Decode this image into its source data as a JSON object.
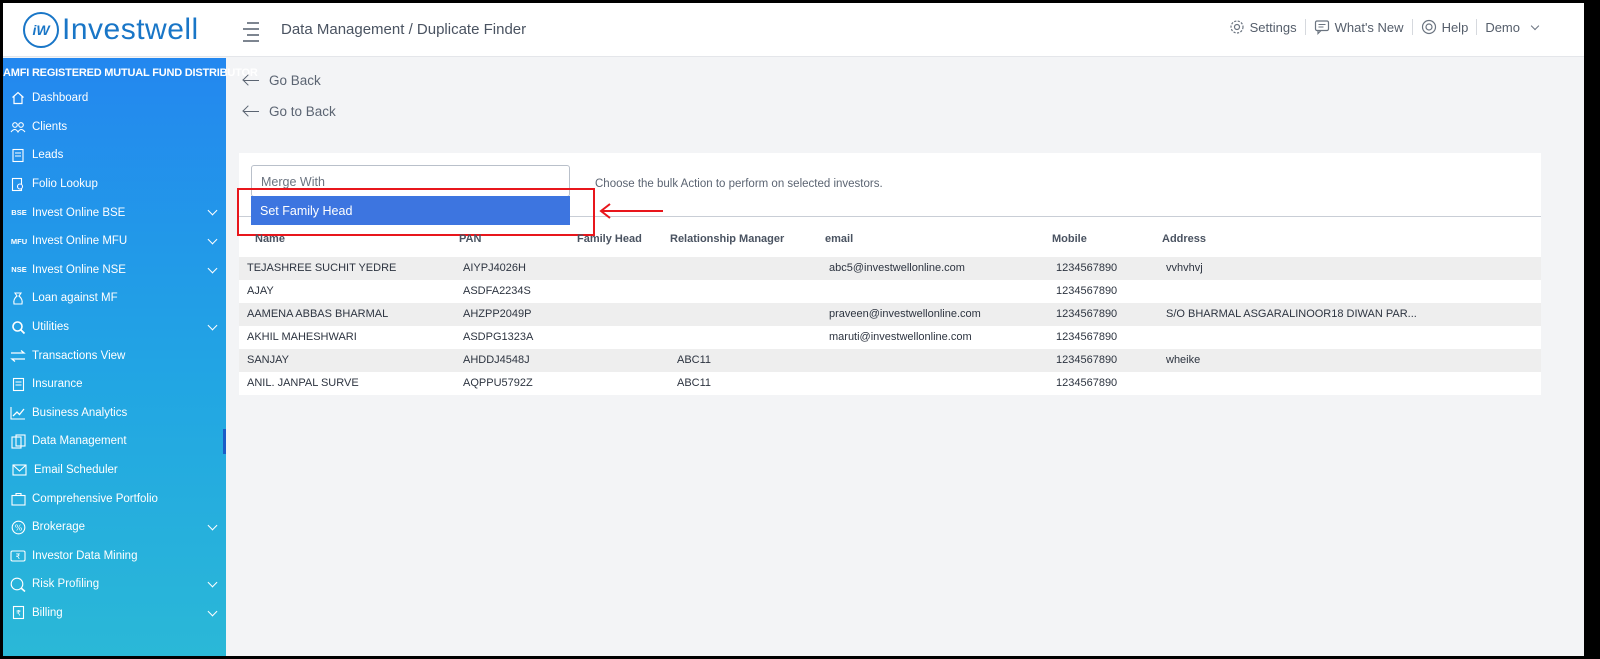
{
  "brand": {
    "logo_mark": "iW",
    "name": "Investwell"
  },
  "header": {
    "breadcrumb": "Data Management / Duplicate Finder",
    "settings": "Settings",
    "whats_new": "What's New",
    "help": "Help",
    "user": "Demo"
  },
  "sidebar": {
    "tagline": "AMFI REGISTERED MUTUAL FUND DISTRIBUTOR",
    "items": [
      {
        "label": "Dashboard",
        "icon": "home-icon"
      },
      {
        "label": "Clients",
        "icon": "clients-icon"
      },
      {
        "label": "Leads",
        "icon": "leads-icon"
      },
      {
        "label": "Folio Lookup",
        "icon": "folio-lookup-icon"
      },
      {
        "label": "Invest Online BSE",
        "icon_text": "BSE"
      },
      {
        "label": "Invest Online MFU",
        "icon_text": "MFU"
      },
      {
        "label": "Invest Online NSE",
        "icon_text": "NSE"
      },
      {
        "label": "Loan against MF",
        "icon": "loan-icon"
      },
      {
        "label": "Utilities",
        "icon": "utilities-icon"
      },
      {
        "label": "Transactions View",
        "icon": "transactions-icon"
      },
      {
        "label": "Insurance",
        "icon": "insurance-icon"
      },
      {
        "label": "Business Analytics",
        "icon": "analytics-icon"
      },
      {
        "label": "Data Management",
        "icon": "data-management-icon"
      },
      {
        "label": "Email Scheduler",
        "icon": "email-icon"
      },
      {
        "label": "Comprehensive Portfolio",
        "icon": "portfolio-icon"
      },
      {
        "label": "Brokerage",
        "icon": "brokerage-icon"
      },
      {
        "label": "Investor Data Mining",
        "icon": "data-mining-icon"
      },
      {
        "label": "Risk Profiling",
        "icon": "risk-icon"
      },
      {
        "label": "Billing",
        "icon": "billing-icon"
      }
    ]
  },
  "main": {
    "go_back": "Go Back",
    "go_to_back": "Go to Back",
    "bulk_action": {
      "placeholder": "Merge With",
      "option_highlighted": "Set Family Head",
      "hint": "Choose the bulk Action to perform on selected investors."
    },
    "table": {
      "headers": [
        "Name",
        "PAN",
        "Family Head",
        "Relationship Manager",
        "email",
        "Mobile",
        "Address"
      ],
      "rows": [
        [
          "TEJASHREE SUCHIT YEDRE",
          "AIYPJ4026H",
          "",
          "",
          "abc5@investwellonline.com",
          "1234567890",
          "vvhvhvj"
        ],
        [
          "AJAY",
          "ASDFA2234S",
          "",
          "",
          "",
          "1234567890",
          ""
        ],
        [
          "AAMENA ABBAS BHARMAL",
          "AHZPP2049P",
          "",
          "",
          "praveen@investwellonline.com",
          "1234567890",
          "S/O BHARMAL ASGARALINOOR18 DIWAN PAR..."
        ],
        [
          "AKHIL MAHESHWARI",
          "ASDPG1323A",
          "",
          "",
          "maruti@investwellonline.com",
          "1234567890",
          ""
        ],
        [
          "SANJAY",
          "AHDDJ4548J",
          "",
          "ABC11",
          "",
          "1234567890",
          "wheike"
        ],
        [
          "ANIL. JANPAL SURVE",
          "AQPPU5792Z",
          "",
          "ABC11",
          "",
          "1234567890",
          ""
        ]
      ]
    }
  },
  "colors": {
    "brand_blue": "#1976c7",
    "sidebar_top": "#2387ef",
    "sidebar_bottom": "#2ab8d7",
    "option_highlight": "#3d75e0",
    "annotation_red": "#e8161c"
  }
}
